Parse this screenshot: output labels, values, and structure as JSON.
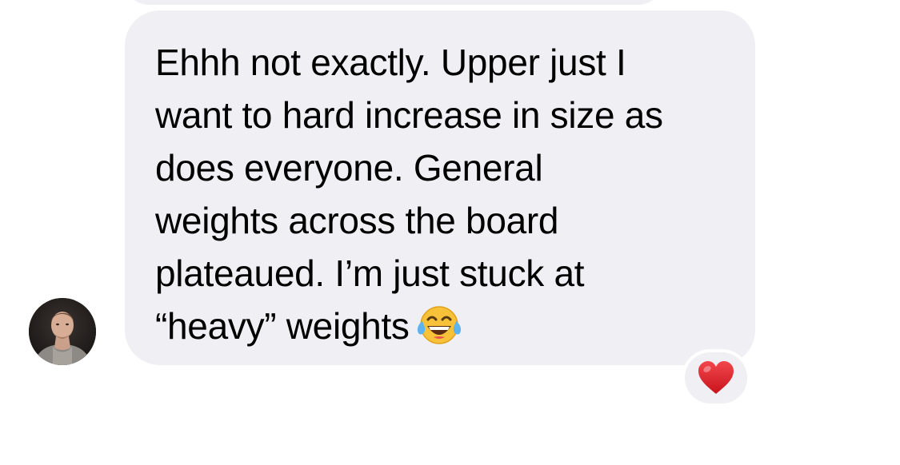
{
  "conversation": {
    "message": {
      "lines": [
        "Ehhh not exactly. Upper just I",
        "want to hard increase in size as",
        "does everyone. General",
        "weights across the board",
        "plateaued. I’m just stuck at",
        "“heavy” weights"
      ],
      "trailing_emoji": "face-with-tears-of-joy",
      "reaction": "heart",
      "sender_avatar": "avatar-photo"
    }
  },
  "colors": {
    "bubble_background": "#efeff4",
    "text": "#000000",
    "heart": "#e0282e",
    "page_background": "#ffffff"
  }
}
